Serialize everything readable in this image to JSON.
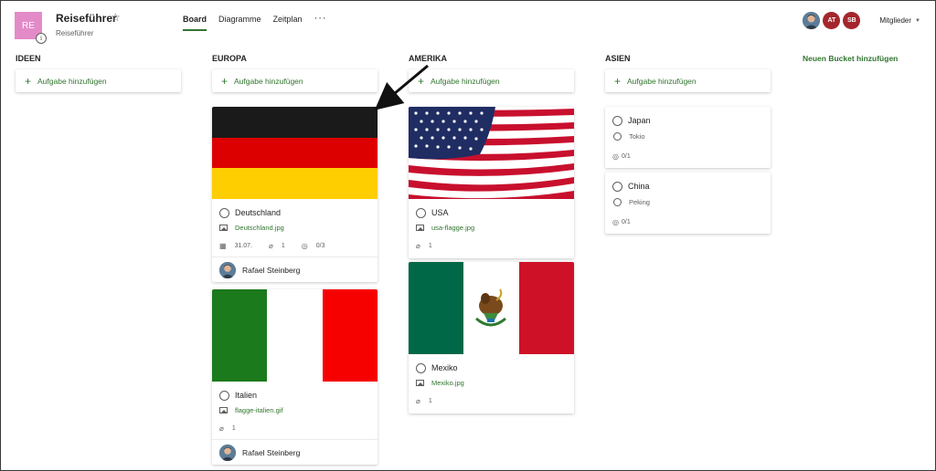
{
  "header": {
    "avatar_initials": "RE",
    "title": "Reiseführer",
    "subtitle": "Reiseführer",
    "tabs": [
      {
        "label": "Board",
        "active": true
      },
      {
        "label": "Diagramme",
        "active": false
      },
      {
        "label": "Zeitplan",
        "active": false
      }
    ],
    "more": "···",
    "members": [
      {
        "initials": "",
        "type": "photo"
      },
      {
        "initials": "AT",
        "type": "initials"
      },
      {
        "initials": "SB",
        "type": "initials"
      }
    ],
    "members_label": "Mitglieder"
  },
  "colors": {
    "accent": "#31752f",
    "plan_avatar": "#e38bc8",
    "member_red": "#a4262c"
  },
  "add_task_label": "Aufgabe hinzufügen",
  "add_bucket_label": "Neuen Bucket hinzufügen",
  "buckets": [
    {
      "title": "IDEEN"
    },
    {
      "title": "EUROPA"
    },
    {
      "title": "AMERIKA"
    },
    {
      "title": "ASIEN"
    }
  ],
  "cards": {
    "deutschland": {
      "title": "Deutschland",
      "attachment": "Deutschland.jpg",
      "due": "31.07.",
      "attachments": "1",
      "checklist": "0/3",
      "assignee": "Rafael Steinberg"
    },
    "italien": {
      "title": "Italien",
      "attachment": "flagge-italien.gif",
      "attachments": "1",
      "assignee": "Rafael Steinberg"
    },
    "usa": {
      "title": "USA",
      "attachment": "usa-flagge.jpg",
      "attachments": "1"
    },
    "mexiko": {
      "title": "Mexiko",
      "attachment": "Mexiko.jpg",
      "attachments": "1"
    },
    "japan": {
      "title": "Japan",
      "checklist_item": "Tokio",
      "checklist": "0/1"
    },
    "china": {
      "title": "China",
      "checklist_item": "Peking",
      "checklist": "0/1"
    }
  },
  "icons": [
    "info-icon",
    "star-icon",
    "plus-icon",
    "image-icon",
    "calendar-icon",
    "paperclip-icon",
    "checklist-icon",
    "chevron-down-icon",
    "arrow-annotation"
  ]
}
